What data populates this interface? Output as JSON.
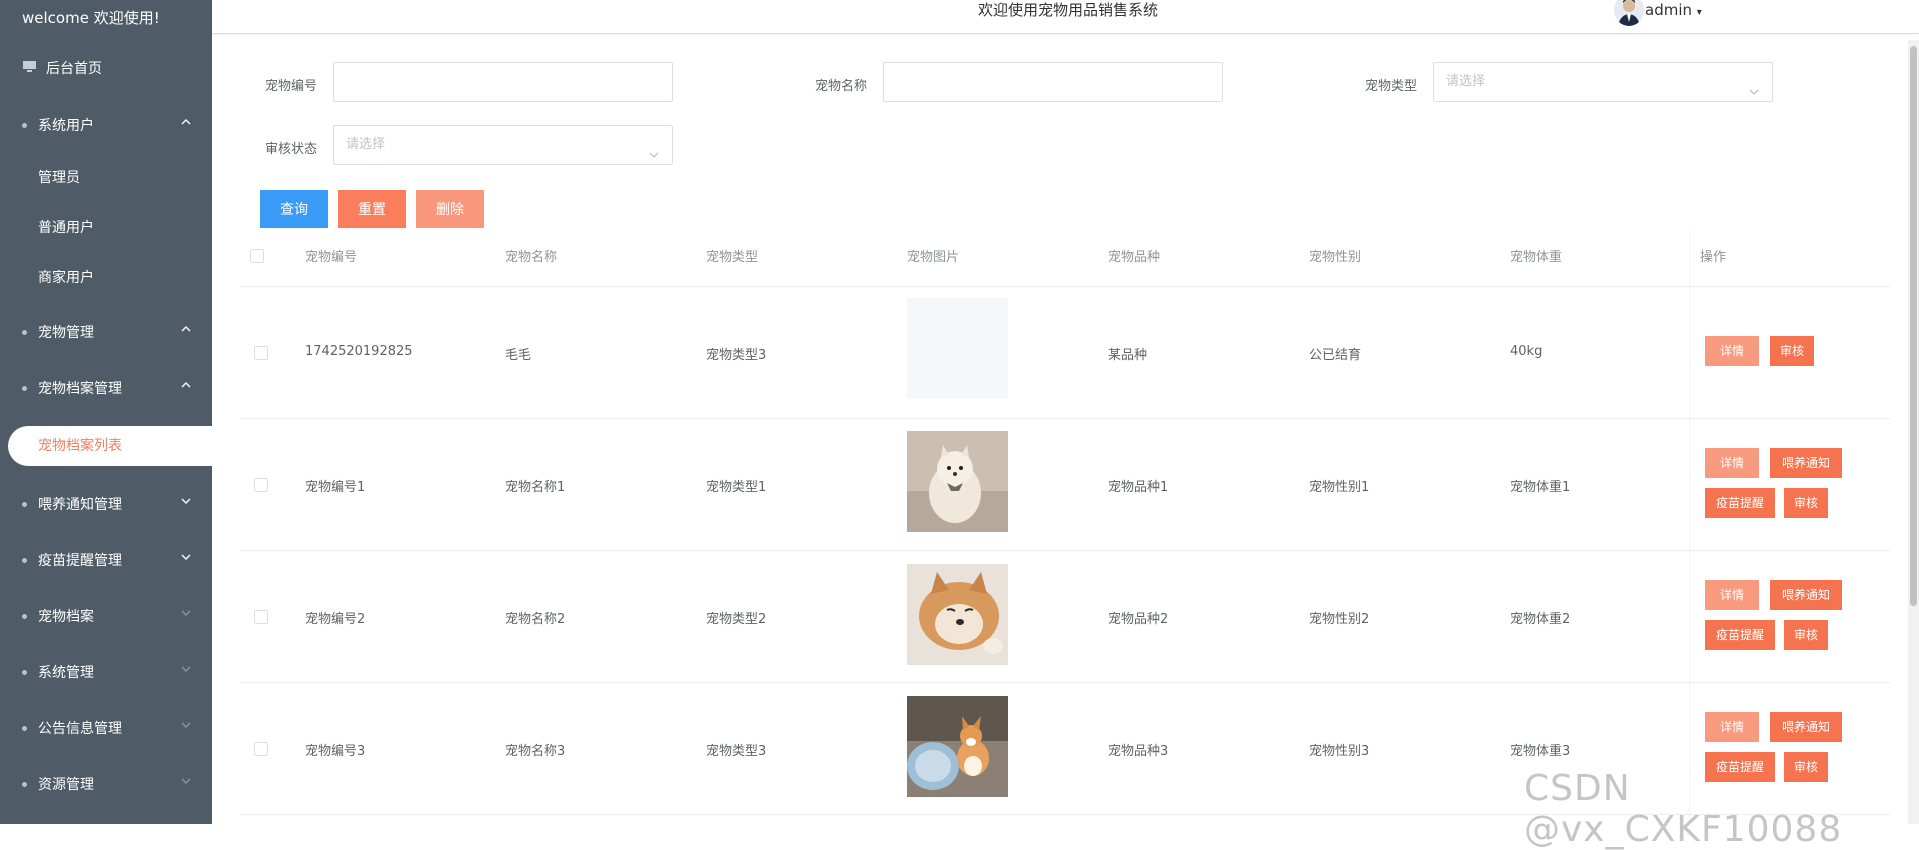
{
  "sidebar": {
    "brand": "welcome 欢迎使用!",
    "home": "后台首页",
    "items": [
      {
        "label": "系统用户",
        "expanded": true
      },
      {
        "label": "宠物管理",
        "expanded": true
      },
      {
        "label": "宠物档案管理",
        "expanded": true
      },
      {
        "label": "喂养通知管理",
        "expanded": false
      },
      {
        "label": "疫苗提醒管理",
        "expanded": false
      },
      {
        "label": "宠物档案",
        "expanded": false
      },
      {
        "label": "系统管理",
        "expanded": false
      },
      {
        "label": "公告信息管理",
        "expanded": false
      },
      {
        "label": "资源管理",
        "expanded": false
      }
    ],
    "sub_items": [
      "管理员",
      "普通用户",
      "商家用户"
    ],
    "active_sub": "宠物档案列表"
  },
  "header": {
    "title": "欢迎使用宠物用品销售系统",
    "user": "admin"
  },
  "search": {
    "pet_no_label": "宠物编号",
    "pet_no_value": "",
    "pet_name_label": "宠物名称",
    "pet_name_value": "",
    "pet_type_label": "宠物类型",
    "pet_type_placeholder": "请选择",
    "audit_label": "审核状态",
    "audit_placeholder": "请选择"
  },
  "buttons": {
    "query": "查询",
    "reset": "重置",
    "delete": "删除"
  },
  "table": {
    "headers": [
      "宠物编号",
      "宠物名称",
      "宠物类型",
      "宠物图片",
      "宠物品种",
      "宠物性别",
      "宠物体重",
      "操作"
    ],
    "rows": [
      {
        "no": "1742520192825",
        "name": "毛毛",
        "type": "宠物类型3",
        "image": "empty",
        "breed": "某品种",
        "gender": "公已结育",
        "weight": "40kg",
        "actions": [
          "详情",
          "审核"
        ]
      },
      {
        "no": "宠物编号1",
        "name": "宠物名称1",
        "type": "宠物类型1",
        "image": "pomeranian",
        "breed": "宠物品种1",
        "gender": "宠物性别1",
        "weight": "宠物体重1",
        "actions": [
          "详情",
          "喂养通知",
          "疫苗提醒",
          "审核"
        ]
      },
      {
        "no": "宠物编号2",
        "name": "宠物名称2",
        "type": "宠物类型2",
        "image": "shiba",
        "breed": "宠物品种2",
        "gender": "宠物性别2",
        "weight": "宠物体重2",
        "actions": [
          "详情",
          "喂养通知",
          "疫苗提醒",
          "审核"
        ]
      },
      {
        "no": "宠物编号3",
        "name": "宠物名称3",
        "type": "宠物类型3",
        "image": "corgi",
        "breed": "宠物品种3",
        "gender": "宠物性别3",
        "weight": "宠物体重3",
        "actions": [
          "详情",
          "喂养通知",
          "疫苗提醒",
          "审核"
        ]
      }
    ]
  },
  "watermark": "CSDN @vx_CXKF10088",
  "colors": {
    "sidebar_bg": "#4f5b66",
    "active_text": "#f08060",
    "query_btn": "#3a9bf7",
    "reset_btn": "#fa7e5c",
    "delete_btn": "#f9977d",
    "action_btn": "#f89a7e"
  }
}
